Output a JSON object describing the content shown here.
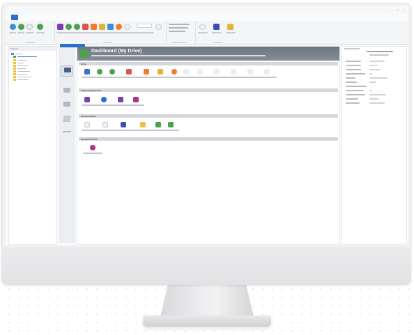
{
  "app": {
    "window_title": "",
    "tabs": [
      {
        "label": "",
        "active": true
      },
      {
        "label": "",
        "active": false
      },
      {
        "label": "",
        "active": false
      }
    ]
  },
  "tree": {
    "header": "Projects"
  },
  "main": {
    "title": "Dashboard (My Drive)",
    "sections": [
      {
        "label": "Drive"
      },
      {
        "label": "Setup & Diagnostics"
      },
      {
        "label": "Documentation"
      },
      {
        "label": "Document Tools"
      }
    ]
  },
  "colors": {
    "accent": "#2b6fd6",
    "header": "#7a828c",
    "green": "#4aa24f",
    "orange": "#ee7d2d",
    "purple": "#7a3fb0",
    "folder": "#f0c040"
  }
}
